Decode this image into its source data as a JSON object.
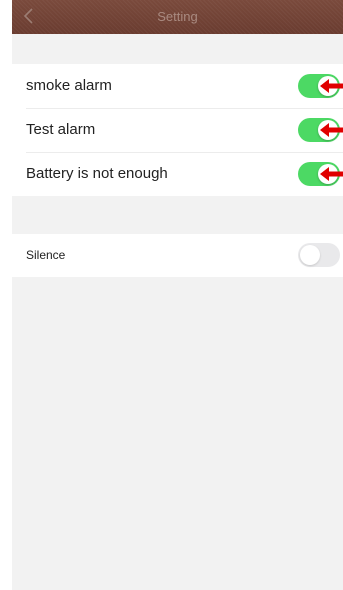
{
  "header": {
    "title": "Setting",
    "back_icon": "chevron-left-icon"
  },
  "alarm_group": {
    "items": [
      {
        "label": "smoke alarm",
        "enabled": true
      },
      {
        "label": "Test alarm",
        "enabled": true
      },
      {
        "label": "Battery is not enough",
        "enabled": true
      }
    ]
  },
  "silence_group": {
    "label": "Silence",
    "enabled": false
  },
  "colors": {
    "toggle_on": "#4cd964",
    "toggle_off": "#e9e9eb",
    "nav_bar": "#6e4034",
    "annotation_arrow": "#e00000"
  }
}
